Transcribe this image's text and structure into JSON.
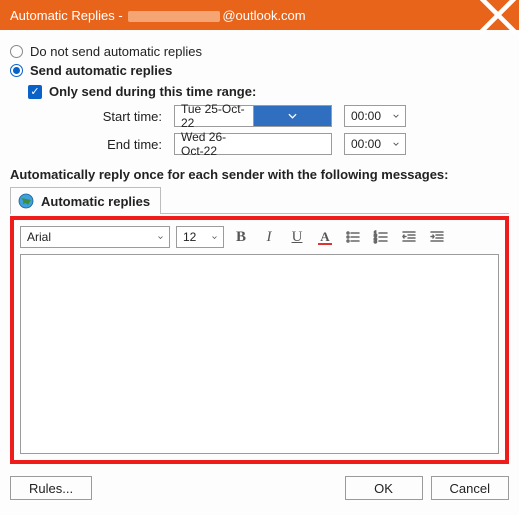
{
  "titlebar": {
    "prefix": "Automatic Replies - ",
    "suffix": "@outlook.com"
  },
  "options": {
    "do_not_send": "Do not send automatic replies",
    "send": "Send automatic replies",
    "only_range": "Only send during this time range:"
  },
  "times": {
    "start_label": "Start time:",
    "start_date": "Tue 25-Oct-22",
    "start_time": "00:00",
    "end_label": "End time:",
    "end_date": "Wed 26-Oct-22",
    "end_time": "00:00"
  },
  "subhead": "Automatically reply once for each sender with the following messages:",
  "tab": "Automatic replies",
  "editor": {
    "font_name": "Arial",
    "font_size": "12",
    "body": ""
  },
  "buttons": {
    "rules": "Rules...",
    "ok": "OK",
    "cancel": "Cancel"
  }
}
